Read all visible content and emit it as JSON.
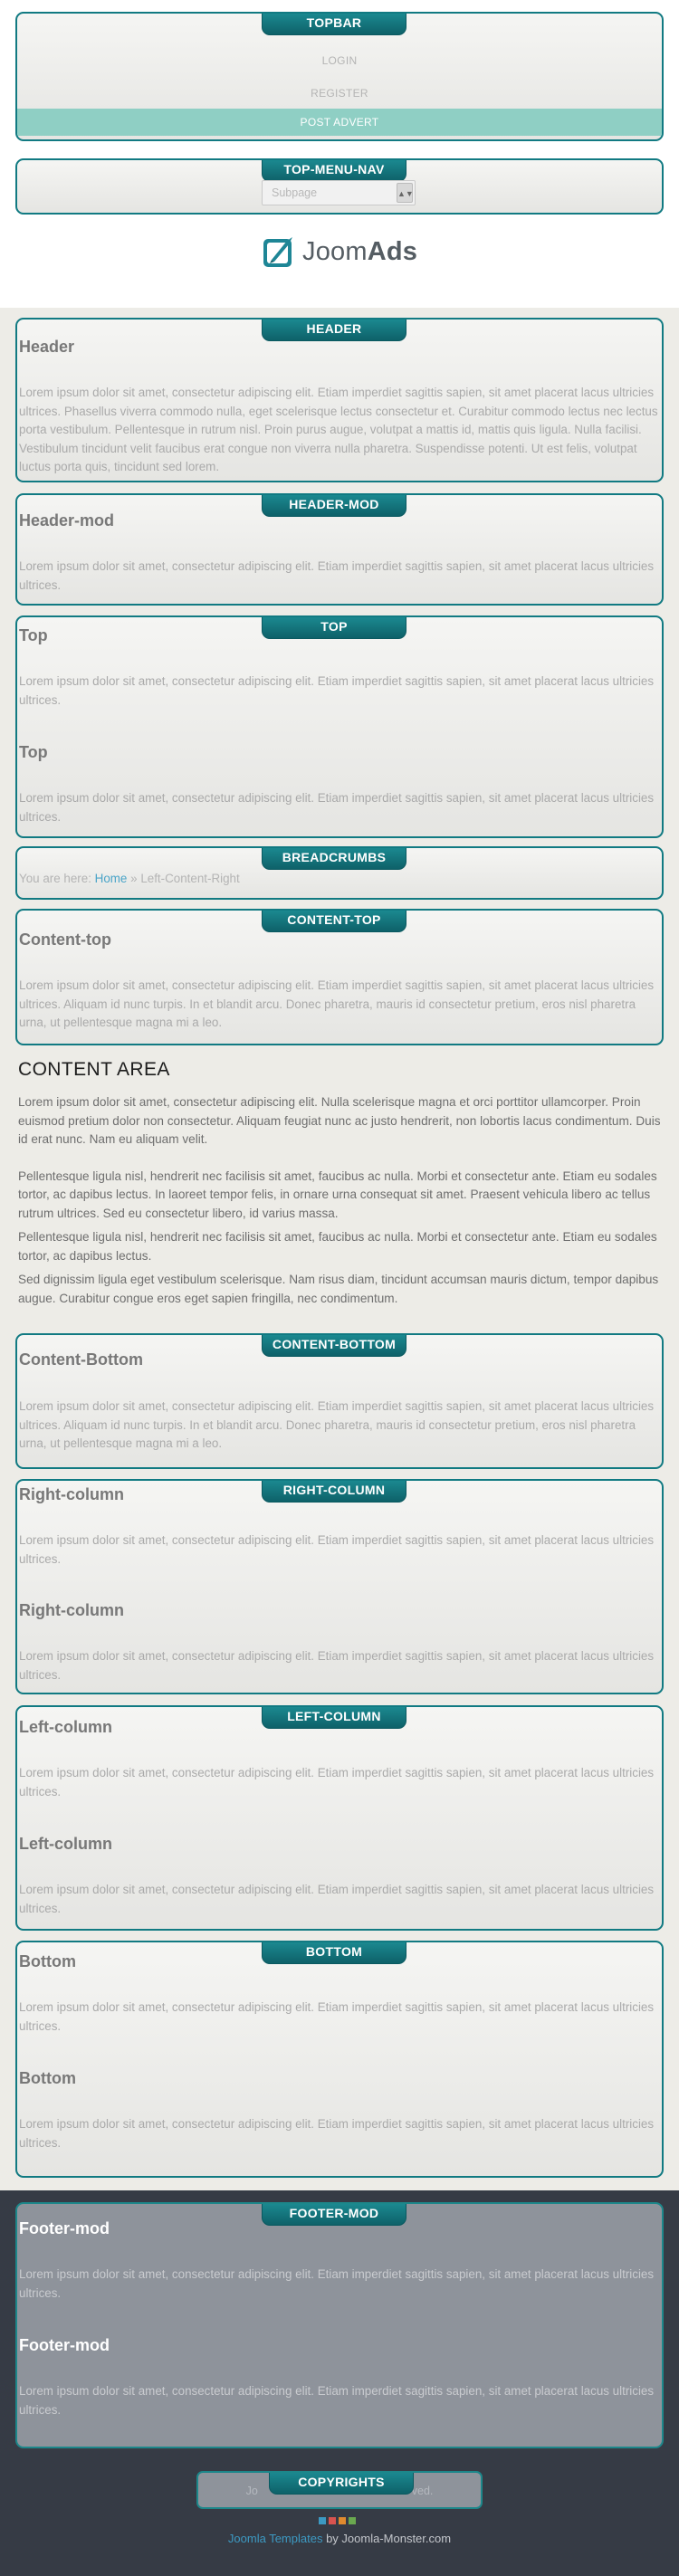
{
  "topbar": {
    "tab": "TOPBAR",
    "links": [
      "LOGIN",
      "REGISTER",
      "POST ADVERT"
    ]
  },
  "top_menu_nav": {
    "tab": "TOP-MENU-NAV",
    "select_value": "Subpage",
    "select_arrow": "▲▼"
  },
  "logo": {
    "brand_regular": "Joom",
    "brand_bold": "Ads"
  },
  "lorem_short": "Lorem ipsum dolor sit amet, consectetur adipiscing elit. Etiam imperdiet sagittis sapien, sit amet placerat lacus ultricies ultrices.",
  "header": {
    "tab": "HEADER",
    "title": "Header",
    "text": "Lorem ipsum dolor sit amet, consectetur adipiscing elit. Etiam imperdiet sagittis sapien, sit amet placerat lacus ultricies ultrices. Phasellus viverra commodo nulla, eget scelerisque lectus consectetur et. Curabitur commodo lectus nec lectus porta vestibulum. Pellentesque in rutrum nisl. Proin purus augue, volutpat a mattis id, mattis quis ligula. Nulla facilisi. Vestibulum tincidunt velit faucibus erat congue non viverra nulla pharetra. Suspendisse potenti. Ut est felis, volutpat luctus porta quis, tincidunt sed lorem."
  },
  "header_mod": {
    "tab": "HEADER-MOD",
    "title": "Header-mod"
  },
  "top": {
    "tab": "TOP",
    "title1": "Top",
    "title2": "Top"
  },
  "breadcrumbs": {
    "tab": "BREADCRUMBS",
    "prefix": "You are here:",
    "home": "Home",
    "separator": "»",
    "current": "Left-Content-Right"
  },
  "content_top": {
    "tab": "CONTENT-TOP",
    "title": "Content-top",
    "text": "Lorem ipsum dolor sit amet, consectetur adipiscing elit. Etiam imperdiet sagittis sapien, sit amet placerat lacus ultricies ultrices. Aliquam id nunc turpis. In et blandit arcu. Donec pharetra, mauris id consectetur pretium, eros nisl pharetra urna, ut pellentesque magna mi a leo."
  },
  "content_area": {
    "title": "CONTENT AREA",
    "p1": "Lorem ipsum dolor sit amet, consectetur adipiscing elit. Nulla scelerisque magna et orci porttitor ullamcorper. Proin euismod pretium dolor non consectetur. Aliquam feugiat nunc ac justo hendrerit, non lobortis lacus condimentum. Duis id erat nunc. Nam eu aliquam velit.",
    "p2": "Pellentesque ligula nisl, hendrerit nec facilisis sit amet, faucibus ac nulla. Morbi et consectetur ante. Etiam eu sodales tortor, ac dapibus lectus. In laoreet tempor felis, in ornare urna consequat sit amet. Praesent vehicula libero ac tellus rutrum ultrices. Sed eu consectetur libero, id varius massa.",
    "p3": "Pellentesque ligula nisl, hendrerit nec facilisis sit amet, faucibus ac nulla. Morbi et consectetur ante. Etiam eu sodales tortor, ac dapibus lectus.",
    "p4": "Sed dignissim ligula eget vestibulum scelerisque. Nam risus diam, tincidunt accumsan mauris dictum, tempor dapibus augue. Curabitur congue eros eget sapien fringilla, nec condimentum."
  },
  "content_bottom": {
    "tab": "CONTENT-BOTTOM",
    "title": "Content-Bottom",
    "text": "Lorem ipsum dolor sit amet, consectetur adipiscing elit. Etiam imperdiet sagittis sapien, sit amet placerat lacus ultricies ultrices. Aliquam id nunc turpis. In et blandit arcu. Donec pharetra, mauris id consectetur pretium, eros nisl pharetra urna, ut pellentesque magna mi a leo."
  },
  "right_column": {
    "tab": "RIGHT-COLUMN",
    "title1": "Right-column",
    "title2": "Right-column"
  },
  "left_column": {
    "tab": "LEFT-COLUMN",
    "title1": "Left-column",
    "title2": "Left-column"
  },
  "bottom": {
    "tab": "BOTTOM",
    "title1": "Bottom",
    "title2": "Bottom"
  },
  "footer_mod": {
    "tab": "FOOTER-MOD",
    "title1": "Footer-mod",
    "title2": "Footer-mod"
  },
  "copyrights": {
    "tab": "COPYRIGHTS",
    "text_left": "Jo",
    "text_right": "ved."
  },
  "credits": {
    "link": "Joomla Templates",
    "suffix": " by Joomla-Monster.com"
  },
  "colors": {
    "accent": "#117a82",
    "square1": "#3c99c2",
    "square2": "#d9534f",
    "square3": "#e08a2e",
    "square4": "#6aa84f"
  }
}
